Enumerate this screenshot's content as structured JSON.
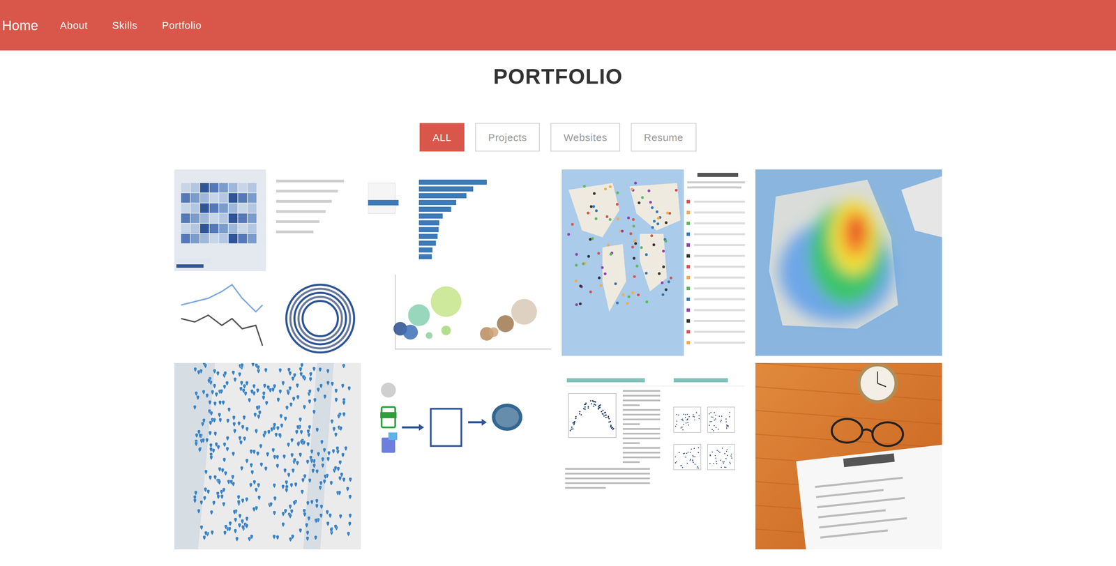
{
  "nav": {
    "brand": "Home",
    "items": [
      {
        "label": "About"
      },
      {
        "label": "Skills"
      },
      {
        "label": "Portfolio"
      }
    ]
  },
  "heading": "PORTFOLIO",
  "filters": [
    {
      "label": "ALL",
      "selected": true
    },
    {
      "label": "Projects",
      "selected": false
    },
    {
      "label": "Websites",
      "selected": false
    },
    {
      "label": "Resume",
      "selected": false
    }
  ],
  "portfolio": {
    "items": [
      {
        "kind": "dashboard"
      },
      {
        "kind": "bacteria"
      },
      {
        "kind": "weathermap"
      },
      {
        "kind": "heatmap"
      },
      {
        "kind": "pinsmap"
      },
      {
        "kind": "etl"
      },
      {
        "kind": "summary"
      },
      {
        "kind": "resume"
      }
    ]
  }
}
